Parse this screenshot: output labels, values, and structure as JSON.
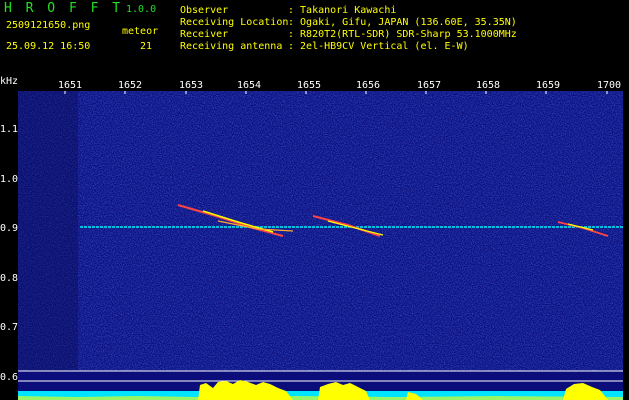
{
  "app": {
    "name": "H R O F F T",
    "version": "1.0.0"
  },
  "file": {
    "name": "2509121650.png",
    "datetime": "25.09.12 16:50"
  },
  "meteor": {
    "label": "meteor",
    "count": "21"
  },
  "info": [
    {
      "label": "Observer",
      "value": ": Takanori Kawachi"
    },
    {
      "label": "Receiving Location",
      "value": ": Ogaki, Gifu, JAPAN (136.60E, 35.35N)"
    },
    {
      "label": "Receiver",
      "value": ": R820T2(RTL-SDR) SDR-Sharp 53.1000MHz"
    },
    {
      "label": "Receiving antenna",
      "value": ": 2el-HB9CV Vertical (el. E-W)"
    }
  ],
  "axis": {
    "y_unit": "kHz",
    "y_ticks": [
      "1.1",
      "1.0",
      "0.9",
      "0.8",
      "0.7",
      "0.6"
    ],
    "x_ticks": [
      "1651",
      "1652",
      "1653",
      "1654",
      "1655",
      "1656",
      "1657",
      "1658",
      "1659",
      "1700"
    ]
  },
  "colors": {
    "background": "#000000",
    "spectrum_bg": "#0b0d7a",
    "carrier": "#00ffff",
    "level": "#ffff00",
    "noise_floor": "#00e5ff",
    "header_text": "#ffff00",
    "app_title": "#22e022"
  }
}
